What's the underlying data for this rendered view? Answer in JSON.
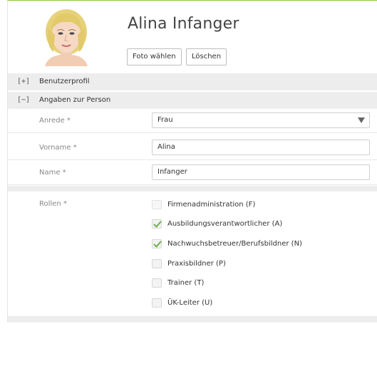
{
  "user": {
    "name": "Alina Infanger",
    "photo_button": "Foto wählen",
    "delete_button": "Löschen"
  },
  "sections": [
    {
      "toggle": "[+]",
      "label": "Benutzerprofil",
      "expanded": false
    },
    {
      "toggle": "[−]",
      "label": "Angaben zur Person",
      "expanded": true
    }
  ],
  "fields": {
    "anrede": {
      "label": "Anrede *",
      "value": "Frau"
    },
    "vorname": {
      "label": "Vorname *",
      "value": "Alina"
    },
    "name": {
      "label": "Name *",
      "value": "Infanger"
    }
  },
  "roles": {
    "label": "Rollen *",
    "items": [
      {
        "label": "Firmenadministration (F)",
        "checked": false,
        "disabled": true
      },
      {
        "label": "Ausbildungsverantwortlicher (A)",
        "checked": true,
        "disabled": false
      },
      {
        "label": "Nachwuchsbetreuer/Berufsbildner (N)",
        "checked": true,
        "disabled": false
      },
      {
        "label": "Praxisbildner (P)",
        "checked": false,
        "disabled": false
      },
      {
        "label": "Trainer (T)",
        "checked": false,
        "disabled": false
      },
      {
        "label": "ÜK-Leiter (U)",
        "checked": false,
        "disabled": false
      }
    ]
  },
  "colors": {
    "accent": "#8cc63f",
    "section_bg": "#ededed",
    "check": "#6ab04c"
  }
}
